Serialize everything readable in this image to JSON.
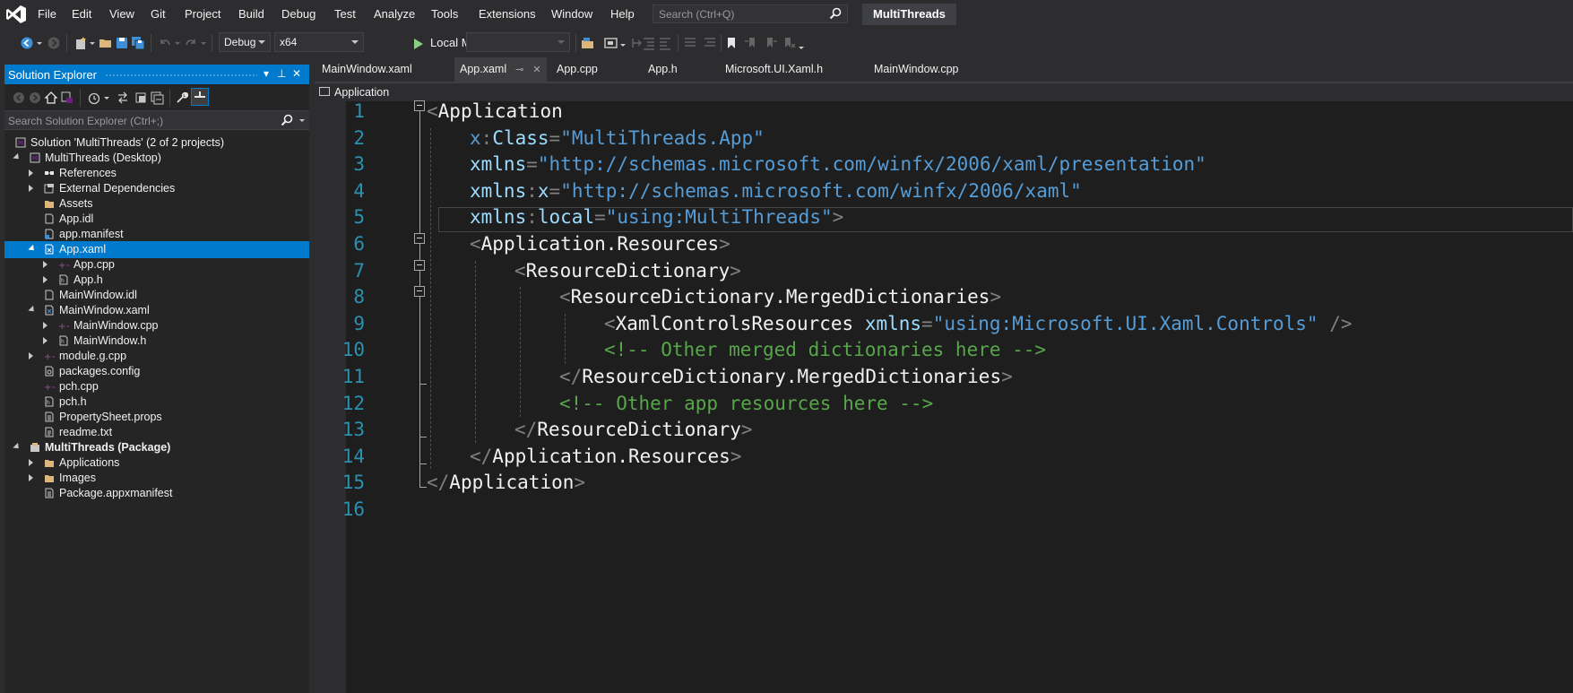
{
  "menubar": {
    "items": [
      "File",
      "Edit",
      "View",
      "Git",
      "Project",
      "Build",
      "Debug",
      "Test",
      "Analyze",
      "Tools",
      "Extensions",
      "Window",
      "Help"
    ],
    "search_placeholder": "Search (Ctrl+Q)",
    "solution_title": "MultiThreads"
  },
  "toolbar": {
    "configuration": "Debug",
    "platform": "x64",
    "run_target": "Local Machine",
    "empty_combo": ""
  },
  "solution_explorer": {
    "title": "Solution Explorer",
    "search_placeholder": "Search Solution Explorer (Ctrl+;)",
    "tree": [
      {
        "label": "Solution 'MultiThreads' (2 of 2 projects)",
        "icon": "solution-icon"
      },
      {
        "label": "MultiThreads (Desktop)",
        "icon": "cpp-project-icon"
      },
      {
        "label": "References",
        "icon": "references-icon"
      },
      {
        "label": "External Dependencies",
        "icon": "dependencies-icon"
      },
      {
        "label": "Assets",
        "icon": "folder-icon"
      },
      {
        "label": "App.idl",
        "icon": "file-icon"
      },
      {
        "label": "app.manifest",
        "icon": "manifest-icon"
      },
      {
        "label": "App.xaml",
        "icon": "xaml-icon"
      },
      {
        "label": "App.cpp",
        "icon": "cpp-file-icon"
      },
      {
        "label": "App.h",
        "icon": "header-file-icon"
      },
      {
        "label": "MainWindow.idl",
        "icon": "file-icon"
      },
      {
        "label": "MainWindow.xaml",
        "icon": "xaml-icon"
      },
      {
        "label": "MainWindow.cpp",
        "icon": "cpp-file-icon"
      },
      {
        "label": "MainWindow.h",
        "icon": "header-file-icon"
      },
      {
        "label": "module.g.cpp",
        "icon": "cpp-file-icon"
      },
      {
        "label": "packages.config",
        "icon": "config-icon"
      },
      {
        "label": "pch.cpp",
        "icon": "cpp-file-icon"
      },
      {
        "label": "pch.h",
        "icon": "header-file-icon"
      },
      {
        "label": "PropertySheet.props",
        "icon": "props-icon"
      },
      {
        "label": "readme.txt",
        "icon": "text-file-icon"
      },
      {
        "label": "MultiThreads (Package)",
        "icon": "package-project-icon"
      },
      {
        "label": "Applications",
        "icon": "folder-icon"
      },
      {
        "label": "Images",
        "icon": "folder-icon"
      },
      {
        "label": "Package.appxmanifest",
        "icon": "manifest-icon"
      }
    ]
  },
  "tabs": [
    {
      "label": "MainWindow.xaml"
    },
    {
      "label": "App.xaml",
      "active": true
    },
    {
      "label": "App.cpp"
    },
    {
      "label": "App.h"
    },
    {
      "label": "Microsoft.UI.Xaml.h"
    },
    {
      "label": "MainWindow.cpp"
    }
  ],
  "nav_bar": {
    "scope": "Application"
  },
  "editor": {
    "line_numbers": [
      "1",
      "2",
      "3",
      "4",
      "5",
      "6",
      "7",
      "8",
      "9",
      "10",
      "11",
      "12",
      "13",
      "14",
      "15",
      "16"
    ],
    "lines": [
      [
        [
          "p",
          "<"
        ],
        [
          "t",
          "Application"
        ]
      ],
      [
        [
          "x",
          "x"
        ],
        [
          "p",
          ":"
        ],
        [
          "a",
          "Class"
        ],
        [
          "p",
          "="
        ],
        [
          "s",
          "\"MultiThreads.App\""
        ]
      ],
      [
        [
          "a",
          "xmlns"
        ],
        [
          "p",
          "="
        ],
        [
          "s",
          "\"http://schemas.microsoft.com/winfx/2006/xaml/presentation\""
        ]
      ],
      [
        [
          "a",
          "xmlns"
        ],
        [
          "p",
          ":"
        ],
        [
          "a",
          "x"
        ],
        [
          "p",
          "="
        ],
        [
          "s",
          "\"http://schemas.microsoft.com/winfx/2006/xaml\""
        ]
      ],
      [
        [
          "a",
          "xmlns"
        ],
        [
          "p",
          ":"
        ],
        [
          "a",
          "local"
        ],
        [
          "p",
          "="
        ],
        [
          "s",
          "\"using:MultiThreads\""
        ],
        [
          "p",
          ">"
        ]
      ],
      [
        [
          "p",
          "<"
        ],
        [
          "t",
          "Application.Resources"
        ],
        [
          "p",
          ">"
        ]
      ],
      [
        [
          "p",
          "<"
        ],
        [
          "t",
          "ResourceDictionary"
        ],
        [
          "p",
          ">"
        ]
      ],
      [
        [
          "p",
          "<"
        ],
        [
          "t",
          "ResourceDictionary.MergedDictionaries"
        ],
        [
          "p",
          ">"
        ]
      ],
      [
        [
          "p",
          "<"
        ],
        [
          "t",
          "XamlControlsResources"
        ],
        [
          "p",
          " "
        ],
        [
          "a",
          "xmlns"
        ],
        [
          "p",
          "="
        ],
        [
          "s",
          "\"using:Microsoft.UI.Xaml.Controls\""
        ],
        [
          "p",
          " />"
        ]
      ],
      [
        [
          "c",
          "<!-- Other merged dictionaries here -->"
        ]
      ],
      [
        [
          "p",
          "</"
        ],
        [
          "t",
          "ResourceDictionary.MergedDictionaries"
        ],
        [
          "p",
          ">"
        ]
      ],
      [
        [
          "c",
          "<!-- Other app resources here -->"
        ]
      ],
      [
        [
          "p",
          "</"
        ],
        [
          "t",
          "ResourceDictionary"
        ],
        [
          "p",
          ">"
        ]
      ],
      [
        [
          "p",
          "</"
        ],
        [
          "t",
          "Application.Resources"
        ],
        [
          "p",
          ">"
        ]
      ],
      [
        [
          "p",
          "</"
        ],
        [
          "t",
          "Application"
        ],
        [
          "p",
          ">"
        ]
      ],
      []
    ]
  },
  "colors": {
    "accent": "#007acc",
    "background": "#2d2d30",
    "editor_background": "#1e1e1e",
    "line_number": "#2b91af",
    "attribute": "#9cdcfe",
    "string": "#569cd6",
    "comment": "#57a64a"
  }
}
